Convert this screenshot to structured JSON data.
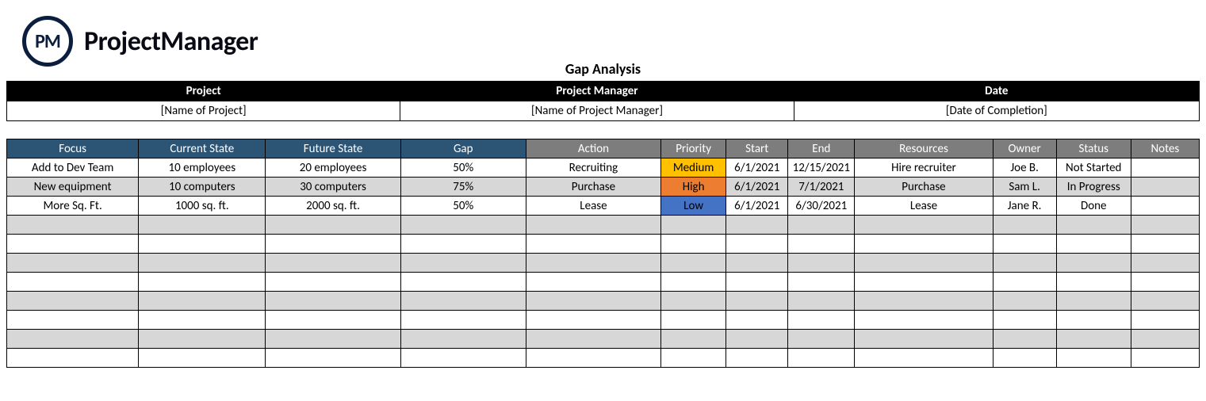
{
  "brand": {
    "logo_initials": "PM",
    "logo_text": "ProjectManager"
  },
  "title": "Gap Analysis",
  "meta": {
    "headers": [
      "Project",
      "Project Manager",
      "Date"
    ],
    "values": [
      "[Name of Project]",
      "[Name of Project Manager]",
      "[Date of Completion]"
    ]
  },
  "columns": [
    "Focus",
    "Current State",
    "Future State",
    "Gap",
    "Action",
    "Priority",
    "Start",
    "End",
    "Resources",
    "Owner",
    "Status",
    "Notes"
  ],
  "rows": [
    {
      "focus": "Add to Dev Team",
      "current": "10 employees",
      "future": "20 employees",
      "gap": "50%",
      "action": "Recruiting",
      "priority": "Medium",
      "start": "6/1/2021",
      "end": "12/15/2021",
      "resources": "Hire recruiter",
      "owner": "Joe B.",
      "status": "Not Started",
      "notes": ""
    },
    {
      "focus": "New equipment",
      "current": "10 computers",
      "future": "30 computers",
      "gap": "75%",
      "action": "Purchase",
      "priority": "High",
      "start": "6/1/2021",
      "end": "7/1/2021",
      "resources": "Purchase",
      "owner": "Sam L.",
      "status": "In Progress",
      "notes": ""
    },
    {
      "focus": "More Sq. Ft.",
      "current": "1000 sq. ft.",
      "future": "2000 sq. ft.",
      "gap": "50%",
      "action": "Lease",
      "priority": "Low",
      "start": "6/1/2021",
      "end": "6/30/2021",
      "resources": "Lease",
      "owner": "Jane R.",
      "status": "Done",
      "notes": ""
    }
  ],
  "empty_rows": 8,
  "priority_colors": {
    "Medium": "#ffc000",
    "High": "#ed7d31",
    "Low": "#4472c4"
  }
}
